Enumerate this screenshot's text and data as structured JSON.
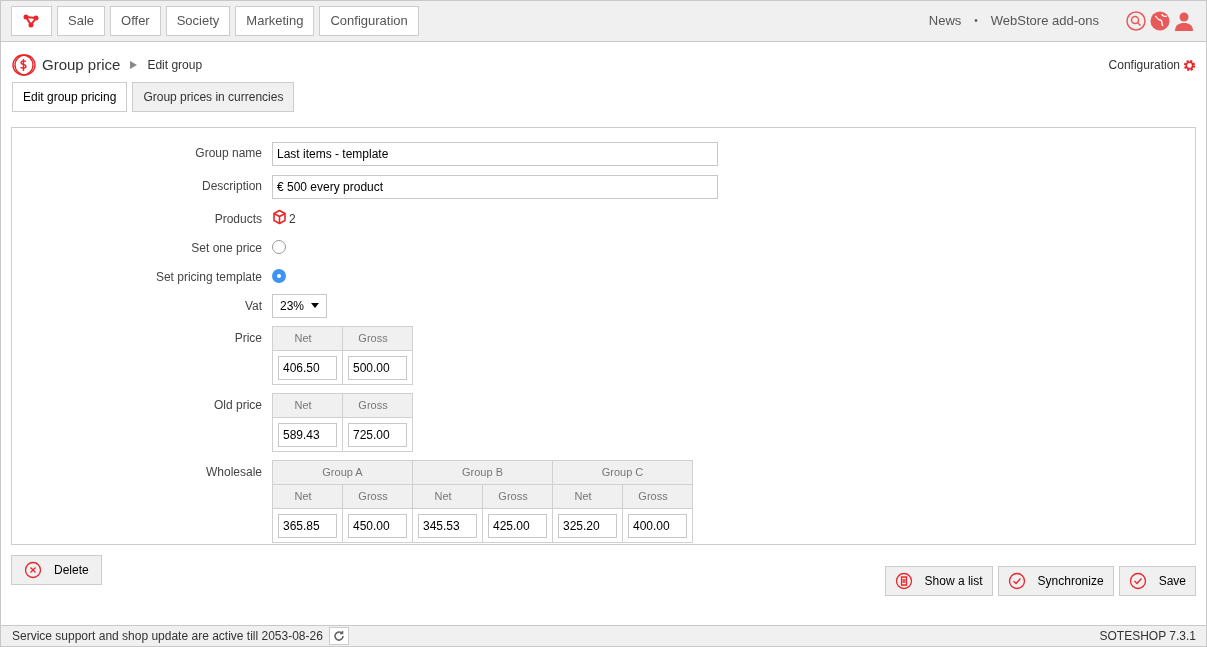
{
  "nav": {
    "items": [
      "Sale",
      "Offer",
      "Society",
      "Marketing",
      "Configuration"
    ]
  },
  "top_links": [
    {
      "label": "News"
    },
    {
      "label": "•",
      "kind": "separator"
    },
    {
      "label": "WebStore add-ons"
    }
  ],
  "breadcrumb": {
    "title": "Group price",
    "current": "Edit group"
  },
  "config_link": "Configuration",
  "tabs": [
    {
      "label": "Edit group pricing",
      "selected": true
    },
    {
      "label": "Group prices in currencies",
      "selected": false
    }
  ],
  "form": [
    {
      "kind": "text",
      "label": "Group name",
      "value": "Last items - template"
    },
    {
      "kind": "text",
      "label": "Description",
      "value": "€ 500 every product"
    },
    {
      "kind": "products",
      "label": "Products",
      "value": "2"
    },
    {
      "kind": "radio",
      "label": "Set one price",
      "selected": false
    },
    {
      "kind": "radio",
      "label": "Set pricing template",
      "selected": true
    },
    {
      "kind": "select",
      "label": "Vat",
      "value": "23%"
    },
    {
      "kind": "prices",
      "label": "Price",
      "groups": [
        {
          "columns": [
            "Net",
            "Gross"
          ],
          "values": [
            "406.50",
            "500.00"
          ]
        }
      ]
    },
    {
      "kind": "prices",
      "label": "Old price",
      "groups": [
        {
          "columns": [
            "Net",
            "Gross"
          ],
          "values": [
            "589.43",
            "725.00"
          ]
        }
      ]
    },
    {
      "kind": "prices",
      "label": "Wholesale",
      "groups": [
        {
          "name": "Group A",
          "columns": [
            "Net",
            "Gross"
          ],
          "values": [
            "365.85",
            "450.00"
          ]
        },
        {
          "name": "Group B",
          "columns": [
            "Net",
            "Gross"
          ],
          "values": [
            "345.53",
            "425.00"
          ]
        },
        {
          "name": "Group C",
          "columns": [
            "Net",
            "Gross"
          ],
          "values": [
            "325.20",
            "400.00"
          ]
        }
      ]
    }
  ],
  "delete_button": "Delete",
  "actions": [
    {
      "label": "Show a list",
      "kind": "list"
    },
    {
      "label": "Synchronize",
      "kind": "check"
    },
    {
      "label": "Save",
      "kind": "check"
    }
  ],
  "status_bar": {
    "message": "Service support and shop update are active till 2053-08-26",
    "version": "SOTESHOP 7.3.1"
  }
}
